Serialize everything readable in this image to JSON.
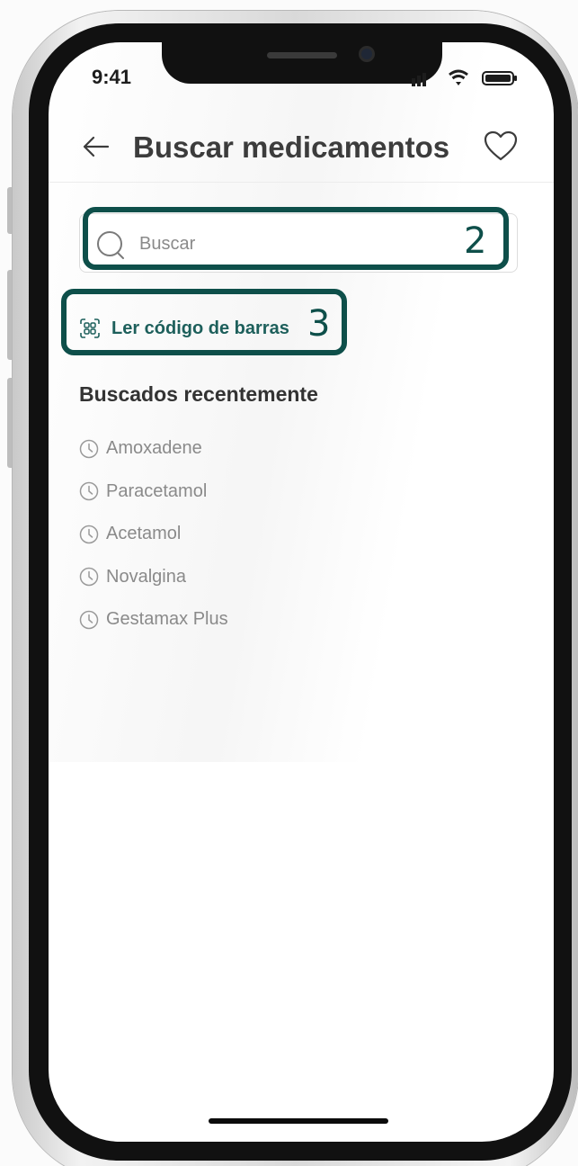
{
  "status_bar": {
    "time": "9:41"
  },
  "header": {
    "title": "Buscar medicamentos",
    "back_icon": "arrow-left-icon",
    "favorite_icon": "heart-icon"
  },
  "search": {
    "placeholder": "Buscar",
    "icon": "search-icon"
  },
  "barcode": {
    "label": "Ler código de barras",
    "icon": "qr-code-icon"
  },
  "recent": {
    "title": "Buscados recentemente",
    "items": [
      {
        "label": "Amoxadene"
      },
      {
        "label": "Paracetamol"
      },
      {
        "label": "Acetamol"
      },
      {
        "label": "Novalgina"
      },
      {
        "label": "Gestamax Plus"
      }
    ]
  },
  "annotations": {
    "search_number": "2",
    "barcode_number": "3"
  },
  "colors": {
    "accent": "#1d5f5b",
    "annotation": "#0e4f4a",
    "text_primary": "#3c3c3c",
    "text_muted": "#8a8a8a"
  }
}
